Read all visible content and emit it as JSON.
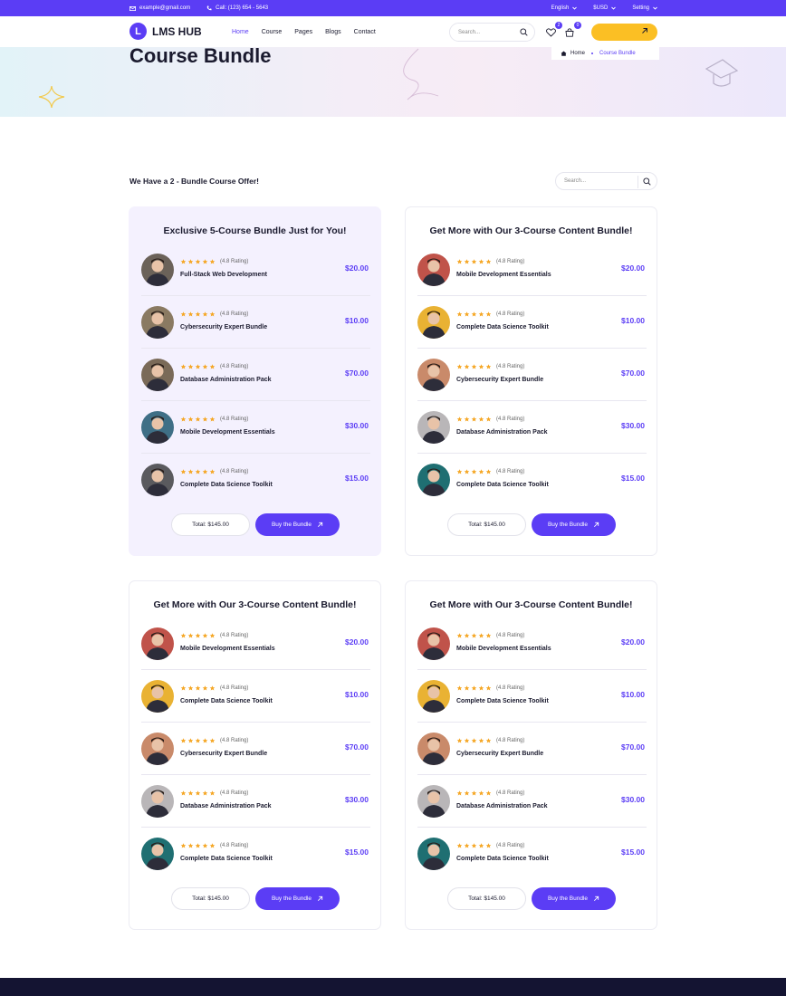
{
  "topbar": {
    "email": "example@gmail.com",
    "phone": "Call: (123) 654 - 5643",
    "language": "English",
    "currency": "$USD",
    "setting": "Setting"
  },
  "nav": {
    "brand": "LMS HUB",
    "brand_mark": "L",
    "menu": [
      "Home",
      "Course",
      "Pages",
      "Blogs",
      "Contact"
    ],
    "search_placeholder": "Search...",
    "wishlist_count": "2",
    "cart_count": "0"
  },
  "hero": {
    "title": "Course Bundle",
    "breadcrumb_home": "Home",
    "breadcrumb_current": "Course Bundle"
  },
  "section": {
    "offer_title": "We Have a 2 - Bundle Course Offer!",
    "search_placeholder": "Search..."
  },
  "cards": [
    {
      "title": "Exclusive 5-Course Bundle Just for You!",
      "total": "Total: $145.00",
      "buy": "Buy the Bundle",
      "items": [
        {
          "name": "Full-Stack Web Development",
          "rating": "(4.8 Rating)",
          "price": "$20.00",
          "avatar": "#6b6259"
        },
        {
          "name": "Cybersecurity Expert Bundle",
          "rating": "(4.8 Rating)",
          "price": "$10.00",
          "avatar": "#8a7a62"
        },
        {
          "name": "Database Administration Pack",
          "rating": "(4.8 Rating)",
          "price": "$70.00",
          "avatar": "#7a6a58"
        },
        {
          "name": "Mobile Development Essentials",
          "rating": "(4.8 Rating)",
          "price": "$30.00",
          "avatar": "#3f6f86"
        },
        {
          "name": "Complete Data Science Toolkit",
          "rating": "(4.8 Rating)",
          "price": "$15.00",
          "avatar": "#5a5a5e"
        }
      ]
    },
    {
      "title": "Get More with Our 3-Course Content Bundle!",
      "total": "Total: $145.00",
      "buy": "Buy the Bundle",
      "items": [
        {
          "name": "Mobile Development Essentials",
          "rating": "(4.8 Rating)",
          "price": "$20.00",
          "avatar": "#c0534a"
        },
        {
          "name": "Complete Data Science Toolkit",
          "rating": "(4.8 Rating)",
          "price": "$10.00",
          "avatar": "#e9b233"
        },
        {
          "name": "Cybersecurity Expert Bundle",
          "rating": "(4.8 Rating)",
          "price": "$70.00",
          "avatar": "#c98a6a"
        },
        {
          "name": "Database Administration Pack",
          "rating": "(4.8 Rating)",
          "price": "$30.00",
          "avatar": "#b9b6b8"
        },
        {
          "name": "Complete Data Science Toolkit",
          "rating": "(4.8 Rating)",
          "price": "$15.00",
          "avatar": "#1f6f72"
        }
      ]
    },
    {
      "title": "Get More with Our 3-Course Content Bundle!",
      "total": "Total: $145.00",
      "buy": "Buy the Bundle",
      "items": [
        {
          "name": "Mobile Development Essentials",
          "rating": "(4.8 Rating)",
          "price": "$20.00",
          "avatar": "#c0534a"
        },
        {
          "name": "Complete Data Science Toolkit",
          "rating": "(4.8 Rating)",
          "price": "$10.00",
          "avatar": "#e9b233"
        },
        {
          "name": "Cybersecurity Expert Bundle",
          "rating": "(4.8 Rating)",
          "price": "$70.00",
          "avatar": "#c98a6a"
        },
        {
          "name": "Database Administration Pack",
          "rating": "(4.8 Rating)",
          "price": "$30.00",
          "avatar": "#b9b6b8"
        },
        {
          "name": "Complete Data Science Toolkit",
          "rating": "(4.8 Rating)",
          "price": "$15.00",
          "avatar": "#1f6f72"
        }
      ]
    },
    {
      "title": "Get More with Our 3-Course Content Bundle!",
      "total": "Total: $145.00",
      "buy": "Buy the Bundle",
      "items": [
        {
          "name": "Mobile Development Essentials",
          "rating": "(4.8 Rating)",
          "price": "$20.00",
          "avatar": "#c0534a"
        },
        {
          "name": "Complete Data Science Toolkit",
          "rating": "(4.8 Rating)",
          "price": "$10.00",
          "avatar": "#e9b233"
        },
        {
          "name": "Cybersecurity Expert Bundle",
          "rating": "(4.8 Rating)",
          "price": "$70.00",
          "avatar": "#c98a6a"
        },
        {
          "name": "Database Administration Pack",
          "rating": "(4.8 Rating)",
          "price": "$30.00",
          "avatar": "#b9b6b8"
        },
        {
          "name": "Complete Data Science Toolkit",
          "rating": "(4.8 Rating)",
          "price": "$15.00",
          "avatar": "#1f6f72"
        }
      ]
    }
  ],
  "colors": {
    "brand": "#5b3df5",
    "accent": "#fbbf24",
    "star": "#f5a623",
    "footer": "#141432"
  },
  "icons": [
    "mail-icon",
    "phone-icon",
    "chevron-down-icon",
    "search-icon",
    "heart-icon",
    "cart-icon",
    "arrow-up-right-icon",
    "home-icon",
    "star-icon"
  ]
}
